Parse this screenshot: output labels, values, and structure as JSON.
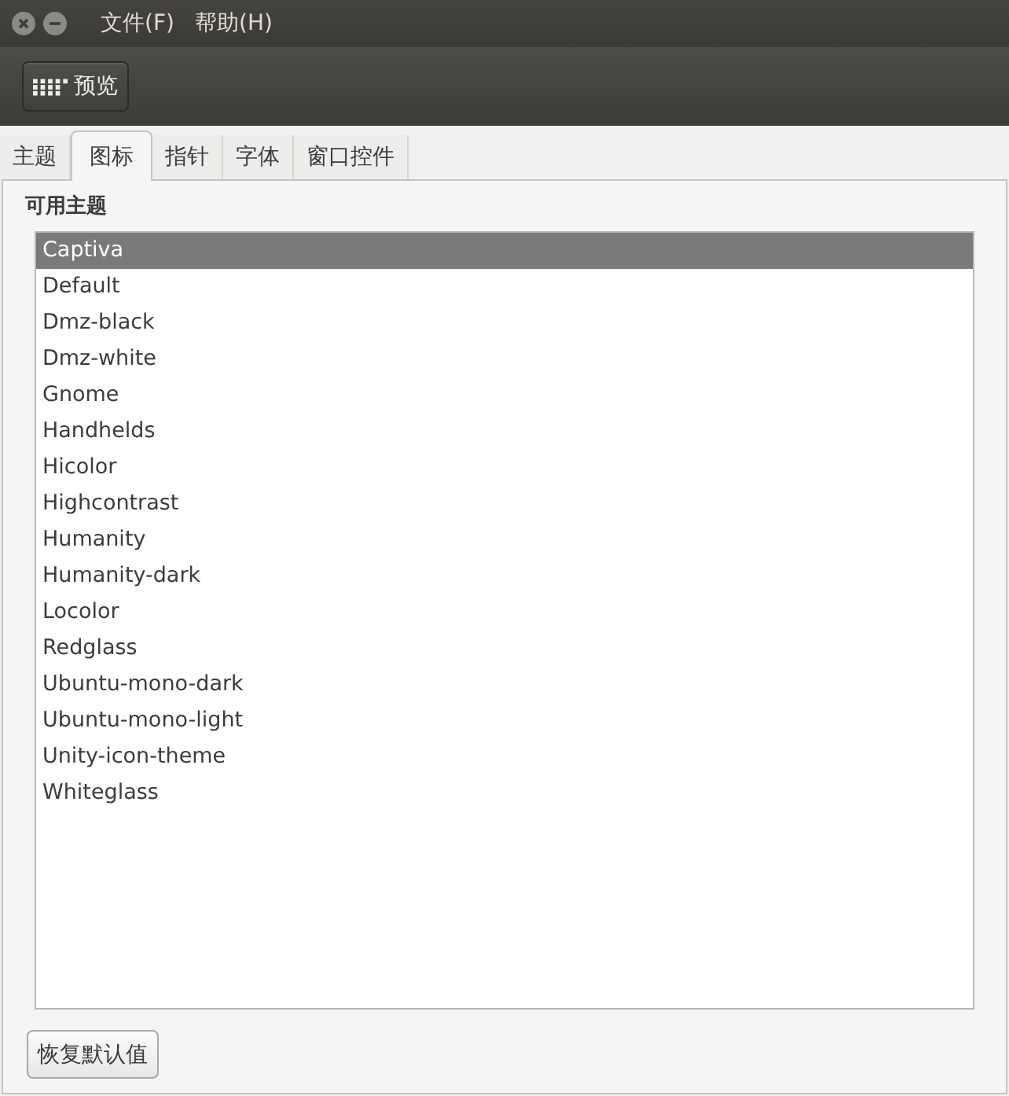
{
  "window": {
    "menu": [
      {
        "label": "文件(F)"
      },
      {
        "label": "帮助(H)"
      }
    ]
  },
  "toolbar": {
    "preview_button": "预览"
  },
  "tabs": [
    {
      "label": "主题",
      "selected": false
    },
    {
      "label": "图标",
      "selected": true
    },
    {
      "label": "指针",
      "selected": false
    },
    {
      "label": "字体",
      "selected": false
    },
    {
      "label": "窗口控件",
      "selected": false
    }
  ],
  "themes_panel": {
    "heading": "可用主题",
    "items": [
      {
        "label": "Captiva",
        "selected": true
      },
      {
        "label": "Default",
        "selected": false
      },
      {
        "label": "Dmz-black",
        "selected": false
      },
      {
        "label": "Dmz-white",
        "selected": false
      },
      {
        "label": "Gnome",
        "selected": false
      },
      {
        "label": "Handhelds",
        "selected": false
      },
      {
        "label": "Hicolor",
        "selected": false
      },
      {
        "label": "Highcontrast",
        "selected": false
      },
      {
        "label": "Humanity",
        "selected": false
      },
      {
        "label": "Humanity-dark",
        "selected": false
      },
      {
        "label": "Locolor",
        "selected": false
      },
      {
        "label": "Redglass",
        "selected": false
      },
      {
        "label": "Ubuntu-mono-dark",
        "selected": false
      },
      {
        "label": "Ubuntu-mono-light",
        "selected": false
      },
      {
        "label": "Unity-icon-theme",
        "selected": false
      },
      {
        "label": "Whiteglass",
        "selected": false
      }
    ]
  },
  "reset_button": "恢复默认值"
}
